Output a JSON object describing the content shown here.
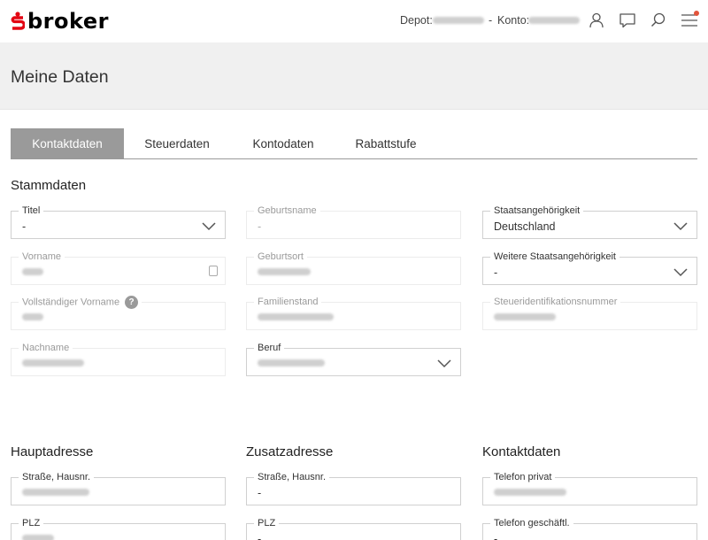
{
  "header": {
    "logo_text": "broker",
    "depot_label": "Depot:",
    "separator": "-",
    "konto_label": "Konto:"
  },
  "page": {
    "title": "Meine Daten"
  },
  "tabs": [
    {
      "label": "Kontaktdaten",
      "active": true
    },
    {
      "label": "Steuerdaten",
      "active": false
    },
    {
      "label": "Kontodaten",
      "active": false
    },
    {
      "label": "Rabattstufe",
      "active": false
    }
  ],
  "stammdaten": {
    "title": "Stammdaten",
    "titel": {
      "label": "Titel",
      "value": "-"
    },
    "vorname": {
      "label": "Vorname"
    },
    "vollstaendiger_vorname": {
      "label": "Vollständiger Vorname",
      "help": "?"
    },
    "nachname": {
      "label": "Nachname"
    },
    "geburtsname": {
      "label": "Geburtsname",
      "value": "-"
    },
    "geburtsort": {
      "label": "Geburtsort"
    },
    "familienstand": {
      "label": "Familienstand"
    },
    "beruf": {
      "label": "Beruf"
    },
    "staatsangehoerigkeit": {
      "label": "Staatsangehörigkeit",
      "value": "Deutschland"
    },
    "weitere_staatsangehoerigkeit": {
      "label": "Weitere Staatsangehörigkeit",
      "value": "-"
    },
    "steuer_id": {
      "label": "Steueridentifikationsnummer"
    }
  },
  "hauptadresse": {
    "title": "Hauptadresse",
    "strasse": {
      "label": "Straße, Hausnr."
    },
    "plz": {
      "label": "PLZ"
    }
  },
  "zusatzadresse": {
    "title": "Zusatzadresse",
    "strasse": {
      "label": "Straße, Hausnr.",
      "value": "-"
    },
    "plz": {
      "label": "PLZ",
      "value": "-"
    }
  },
  "kontaktdaten": {
    "title": "Kontaktdaten",
    "telefon_privat": {
      "label": "Telefon privat"
    },
    "telefon_geschaeftl": {
      "label": "Telefon geschäftl.",
      "value": "-"
    }
  },
  "colors": {
    "brand": "#e30613",
    "tab_active": "#9a9a9a",
    "notification": "#e2543b"
  }
}
